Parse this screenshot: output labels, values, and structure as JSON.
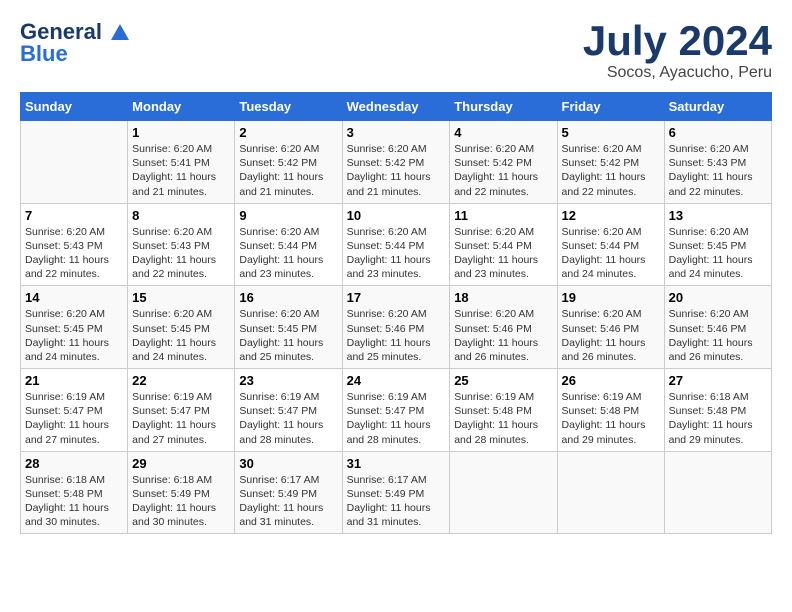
{
  "header": {
    "logo_line1": "General",
    "logo_line2": "Blue",
    "month": "July 2024",
    "location": "Socos, Ayacucho, Peru"
  },
  "days_of_week": [
    "Sunday",
    "Monday",
    "Tuesday",
    "Wednesday",
    "Thursday",
    "Friday",
    "Saturday"
  ],
  "weeks": [
    [
      {
        "day": "",
        "info": ""
      },
      {
        "day": "1",
        "info": "Sunrise: 6:20 AM\nSunset: 5:41 PM\nDaylight: 11 hours\nand 21 minutes."
      },
      {
        "day": "2",
        "info": "Sunrise: 6:20 AM\nSunset: 5:42 PM\nDaylight: 11 hours\nand 21 minutes."
      },
      {
        "day": "3",
        "info": "Sunrise: 6:20 AM\nSunset: 5:42 PM\nDaylight: 11 hours\nand 21 minutes."
      },
      {
        "day": "4",
        "info": "Sunrise: 6:20 AM\nSunset: 5:42 PM\nDaylight: 11 hours\nand 22 minutes."
      },
      {
        "day": "5",
        "info": "Sunrise: 6:20 AM\nSunset: 5:42 PM\nDaylight: 11 hours\nand 22 minutes."
      },
      {
        "day": "6",
        "info": "Sunrise: 6:20 AM\nSunset: 5:43 PM\nDaylight: 11 hours\nand 22 minutes."
      }
    ],
    [
      {
        "day": "7",
        "info": ""
      },
      {
        "day": "8",
        "info": "Sunrise: 6:20 AM\nSunset: 5:43 PM\nDaylight: 11 hours\nand 22 minutes."
      },
      {
        "day": "9",
        "info": "Sunrise: 6:20 AM\nSunset: 5:44 PM\nDaylight: 11 hours\nand 23 minutes."
      },
      {
        "day": "10",
        "info": "Sunrise: 6:20 AM\nSunset: 5:44 PM\nDaylight: 11 hours\nand 23 minutes."
      },
      {
        "day": "11",
        "info": "Sunrise: 6:20 AM\nSunset: 5:44 PM\nDaylight: 11 hours\nand 23 minutes."
      },
      {
        "day": "12",
        "info": "Sunrise: 6:20 AM\nSunset: 5:44 PM\nDaylight: 11 hours\nand 24 minutes."
      },
      {
        "day": "13",
        "info": "Sunrise: 6:20 AM\nSunset: 5:45 PM\nDaylight: 11 hours\nand 24 minutes."
      }
    ],
    [
      {
        "day": "14",
        "info": ""
      },
      {
        "day": "15",
        "info": "Sunrise: 6:20 AM\nSunset: 5:45 PM\nDaylight: 11 hours\nand 24 minutes."
      },
      {
        "day": "16",
        "info": "Sunrise: 6:20 AM\nSunset: 5:45 PM\nDaylight: 11 hours\nand 25 minutes."
      },
      {
        "day": "17",
        "info": "Sunrise: 6:20 AM\nSunset: 5:46 PM\nDaylight: 11 hours\nand 25 minutes."
      },
      {
        "day": "18",
        "info": "Sunrise: 6:20 AM\nSunset: 5:46 PM\nDaylight: 11 hours\nand 26 minutes."
      },
      {
        "day": "19",
        "info": "Sunrise: 6:20 AM\nSunset: 5:46 PM\nDaylight: 11 hours\nand 26 minutes."
      },
      {
        "day": "20",
        "info": "Sunrise: 6:20 AM\nSunset: 5:46 PM\nDaylight: 11 hours\nand 26 minutes."
      }
    ],
    [
      {
        "day": "21",
        "info": ""
      },
      {
        "day": "22",
        "info": "Sunrise: 6:19 AM\nSunset: 5:47 PM\nDaylight: 11 hours\nand 27 minutes."
      },
      {
        "day": "23",
        "info": "Sunrise: 6:19 AM\nSunset: 5:47 PM\nDaylight: 11 hours\nand 28 minutes."
      },
      {
        "day": "24",
        "info": "Sunrise: 6:19 AM\nSunset: 5:47 PM\nDaylight: 11 hours\nand 28 minutes."
      },
      {
        "day": "25",
        "info": "Sunrise: 6:19 AM\nSunset: 5:48 PM\nDaylight: 11 hours\nand 28 minutes."
      },
      {
        "day": "26",
        "info": "Sunrise: 6:19 AM\nSunset: 5:48 PM\nDaylight: 11 hours\nand 29 minutes."
      },
      {
        "day": "27",
        "info": "Sunrise: 6:18 AM\nSunset: 5:48 PM\nDaylight: 11 hours\nand 29 minutes."
      }
    ],
    [
      {
        "day": "28",
        "info": "Sunrise: 6:18 AM\nSunset: 5:48 PM\nDaylight: 11 hours\nand 30 minutes."
      },
      {
        "day": "29",
        "info": "Sunrise: 6:18 AM\nSunset: 5:49 PM\nDaylight: 11 hours\nand 30 minutes."
      },
      {
        "day": "30",
        "info": "Sunrise: 6:17 AM\nSunset: 5:49 PM\nDaylight: 11 hours\nand 31 minutes."
      },
      {
        "day": "31",
        "info": "Sunrise: 6:17 AM\nSunset: 5:49 PM\nDaylight: 11 hours\nand 31 minutes."
      },
      {
        "day": "",
        "info": ""
      },
      {
        "day": "",
        "info": ""
      },
      {
        "day": "",
        "info": ""
      }
    ]
  ],
  "week7_sunday": {
    "info": "Sunrise: 6:20 AM\nSunset: 5:43 PM\nDaylight: 11 hours\nand 22 minutes."
  },
  "week14_sunday": {
    "info": "Sunrise: 6:20 AM\nSunset: 5:45 PM\nDaylight: 11 hours\nand 24 minutes."
  },
  "week21_sunday": {
    "info": "Sunrise: 6:19 AM\nSunset: 5:47 PM\nDaylight: 11 hours\nand 27 minutes."
  }
}
